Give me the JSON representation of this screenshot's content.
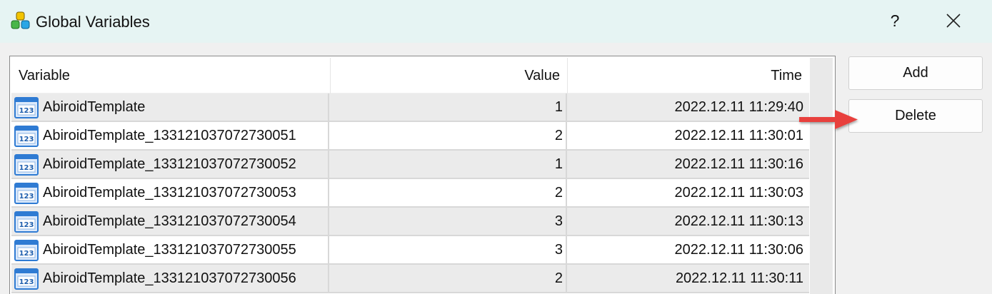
{
  "window": {
    "title": "Global Variables",
    "help_label": "?",
    "icons": {
      "app": "global-variables-app-icon",
      "close": "close-icon"
    }
  },
  "table": {
    "columns": {
      "variable": "Variable",
      "value": "Value",
      "time": "Time"
    },
    "row_icon": "numeric-123-icon",
    "rows": [
      {
        "variable": "AbiroidTemplate",
        "value": "1",
        "time": "2022.12.11 11:29:40"
      },
      {
        "variable": "AbiroidTemplate_133121037072730051",
        "value": "2",
        "time": "2022.12.11 11:30:01"
      },
      {
        "variable": "AbiroidTemplate_133121037072730052",
        "value": "1",
        "time": "2022.12.11 11:30:16"
      },
      {
        "variable": "AbiroidTemplate_133121037072730053",
        "value": "2",
        "time": "2022.12.11 11:30:03"
      },
      {
        "variable": "AbiroidTemplate_133121037072730054",
        "value": "3",
        "time": "2022.12.11 11:30:13"
      },
      {
        "variable": "AbiroidTemplate_133121037072730055",
        "value": "3",
        "time": "2022.12.11 11:30:06"
      },
      {
        "variable": "AbiroidTemplate_133121037072730056",
        "value": "2",
        "time": "2022.12.11 11:30:11"
      }
    ]
  },
  "buttons": {
    "add": "Add",
    "delete": "Delete"
  },
  "colors": {
    "titlebar": "#e6f4f3",
    "row_alt": "#ebebeb",
    "arrow": "#e8413c",
    "icon_blue": "#2f7bd3"
  }
}
